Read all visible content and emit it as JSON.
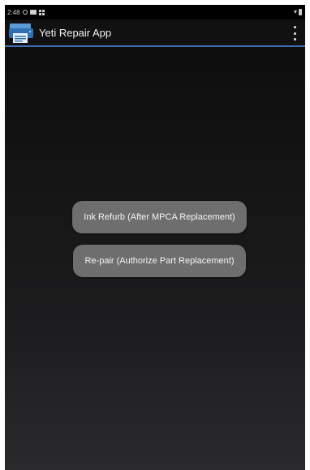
{
  "status_bar": {
    "time": "2:48",
    "icons": [
      "settings-icon",
      "message-icon",
      "grid-icon",
      "wifi-icon",
      "battery-icon"
    ]
  },
  "app_bar": {
    "title": "Yeti Repair App",
    "logo_icon": "printer-icon",
    "menu_icon": "overflow-menu-icon",
    "divider_color": "#3f6fb5"
  },
  "actions": {
    "ink_refurb_label": "Ink Refurb (After MPCA Replacement)",
    "repair_label": "Re-pair (Authorize Part Replacement)"
  },
  "colors": {
    "button_bg": "#6e6e6e",
    "button_text": "#f4f4f4",
    "accent": "#3f6fb5"
  }
}
